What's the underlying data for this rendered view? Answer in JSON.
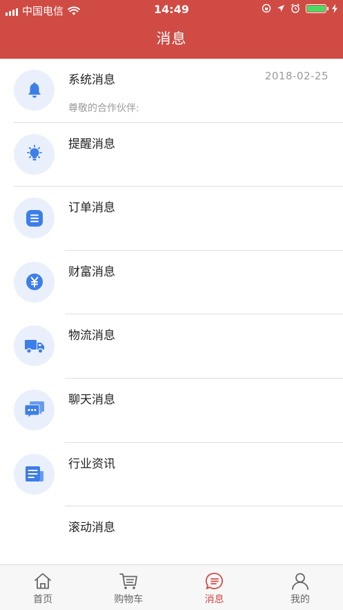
{
  "status_bar": {
    "carrier": "中国电信",
    "time": "14:49"
  },
  "header": {
    "title": "消息"
  },
  "messages": [
    {
      "title": "系统消息",
      "date": "2018-02-25",
      "preview": "尊敬的合作伙伴:",
      "icon": "bell-icon"
    },
    {
      "title": "提醒消息",
      "icon": "lightbulb-icon"
    },
    {
      "title": "订单消息",
      "icon": "order-list-icon"
    },
    {
      "title": "财富消息",
      "icon": "yen-coin-icon"
    },
    {
      "title": "物流消息",
      "icon": "truck-icon"
    },
    {
      "title": "聊天消息",
      "icon": "chat-bubbles-icon"
    },
    {
      "title": "行业资讯",
      "icon": "newspaper-icon"
    },
    {
      "title": "滚动消息"
    }
  ],
  "tabs": [
    {
      "label": "首页",
      "icon": "home-icon"
    },
    {
      "label": "购物车",
      "icon": "cart-icon"
    },
    {
      "label": "消息",
      "icon": "message-icon",
      "active": true
    },
    {
      "label": "我的",
      "icon": "user-icon"
    }
  ],
  "colors": {
    "header": "#cf4b44",
    "icon_blue": "#3d7ee8",
    "icon_bg": "#e9f0fb",
    "tab_active": "#cf4b44"
  }
}
